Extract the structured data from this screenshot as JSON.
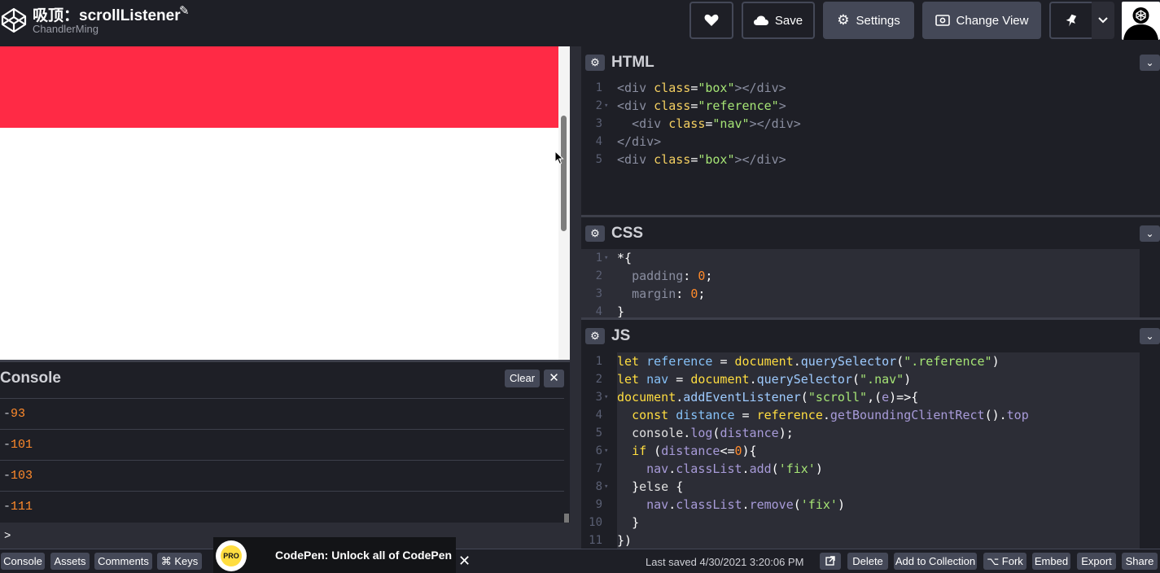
{
  "header": {
    "title": "吸顶：scrollListener",
    "author": "ChandlerMing",
    "save_label": "Save",
    "settings_label": "Settings",
    "change_view_label": "Change View"
  },
  "console": {
    "title": "Console",
    "clear_label": "Clear",
    "lines": [
      "93",
      "101",
      "103",
      "111"
    ],
    "prompt": ">"
  },
  "editors": {
    "html": {
      "title": "HTML"
    },
    "css": {
      "title": "CSS"
    },
    "js": {
      "title": "JS"
    }
  },
  "footer": {
    "console_label": "Console",
    "assets_label": "Assets",
    "comments_label": "Comments",
    "keys_label": "⌘ Keys",
    "promo_text": "CodePen: Unlock all of CodePen",
    "promo_badge": "PRO",
    "last_saved": "Last saved 4/30/2021 3:20:06 PM",
    "delete_label": "Delete",
    "collection_label": "Add to Collection",
    "fork_label": "Fork",
    "embed_label": "Embed",
    "export_label": "Export",
    "share_label": "Share"
  },
  "colors": {
    "preview_box": "#ff2a45",
    "background": "#131417",
    "panel": "#1e1f26",
    "button": "#444857"
  },
  "icons": [
    "codepen-logo-icon",
    "pencil-icon",
    "heart-icon",
    "cloud-icon",
    "gear-icon",
    "eye-icon",
    "pin-icon",
    "chevron-down-icon",
    "close-icon",
    "external-link-icon",
    "fork-icon"
  ]
}
